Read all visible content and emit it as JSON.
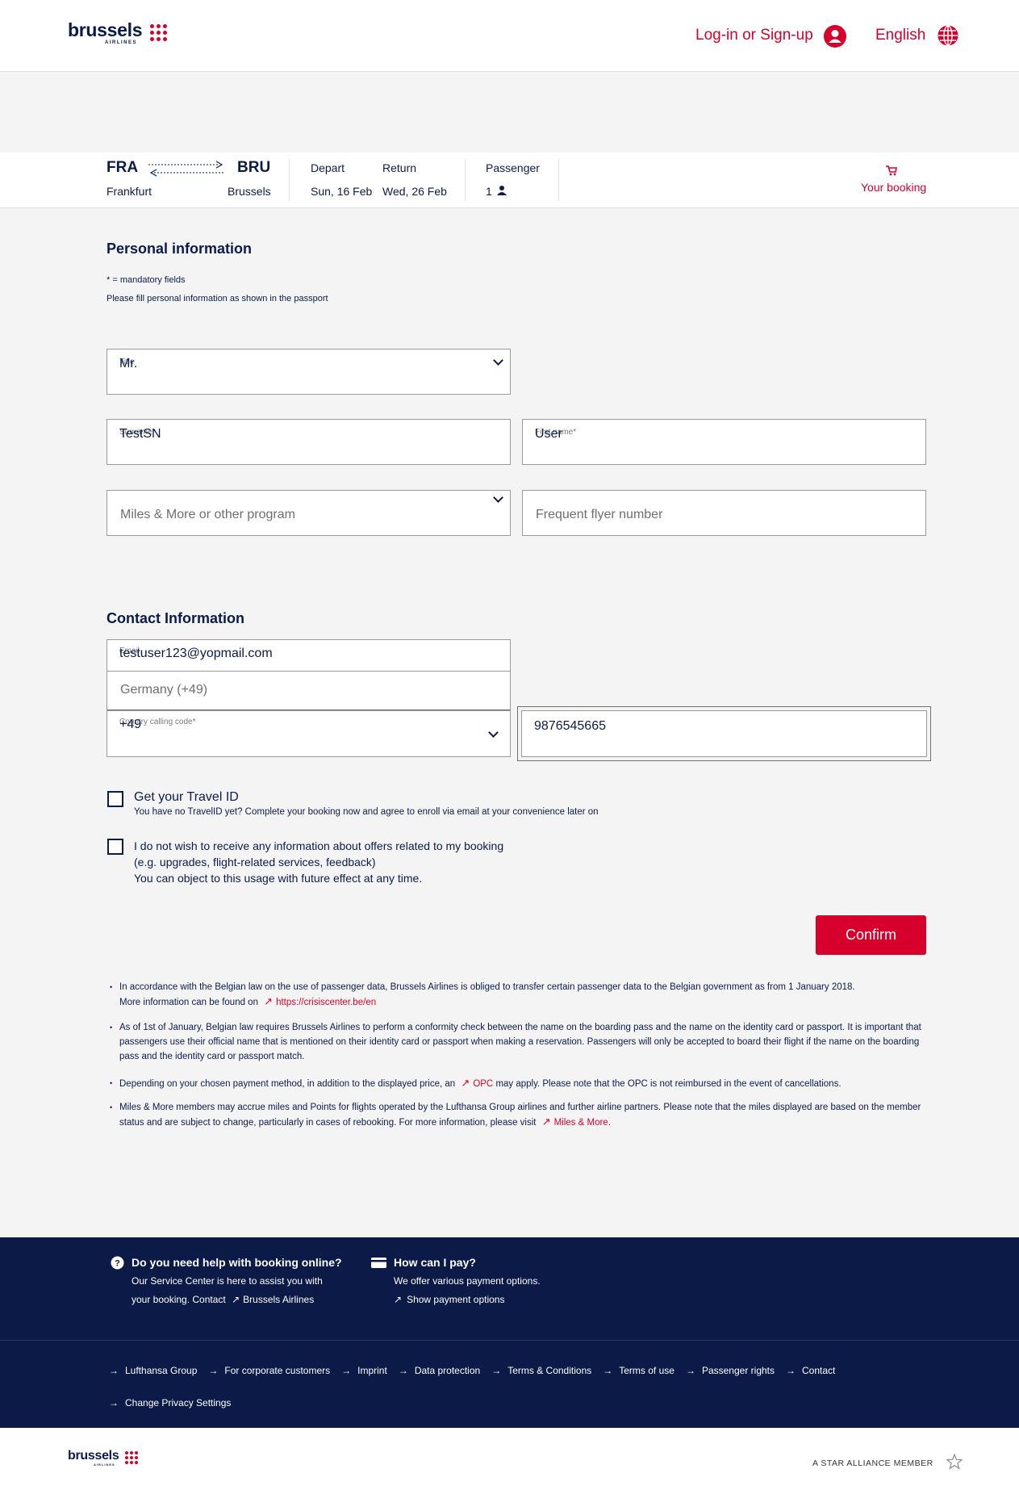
{
  "header": {
    "logo_word": "brussels",
    "logo_sub": "AIRLINES",
    "login_label": "Log-in or Sign-up",
    "language_label": "English"
  },
  "summary": {
    "origin_code": "FRA",
    "origin_city": "Frankfurt",
    "destination_code": "BRU",
    "destination_city": "Brussels",
    "depart_label": "Depart",
    "depart_date": "Sun, 16 Feb",
    "return_label": "Return",
    "return_date": "Wed, 26 Feb",
    "passenger_label": "Passenger",
    "passenger_count": "1",
    "booking_label": "Your booking"
  },
  "personal": {
    "title": "Personal information",
    "mandatory_note": "* = mandatory fields",
    "passport_note": "Please fill personal information as shown in the passport",
    "title_field": {
      "label": "Title",
      "value": "Mr."
    },
    "surname_field": {
      "label": "Surname*",
      "value": "TestSN"
    },
    "first_name_field": {
      "label": "First name*",
      "value": "User"
    },
    "program_field": {
      "placeholder": "Miles & More or other program"
    },
    "ff_number_field": {
      "placeholder": "Frequent flyer number"
    }
  },
  "contact": {
    "title": "Contact Information",
    "email_field": {
      "label": "Email",
      "value": "testuser123@yopmail.com"
    },
    "country_option": "Germany (+49)",
    "calling_code_field": {
      "label": "Country calling code*",
      "value": "+49"
    },
    "phone_field": {
      "value": "9876545665"
    }
  },
  "travel_id": {
    "title": "Get your Travel ID",
    "text": "You have no TravelID yet? Complete your booking now and agree to enroll via email at your convenience later on"
  },
  "marketing": {
    "line1": "I do not wish to receive any information about offers related to my booking",
    "line2": "(e.g. upgrades, flight-related services, feedback)",
    "line3": "You can object to this usage with future effect at any time."
  },
  "confirm_label": "Confirm",
  "notes": {
    "n1_a": "In accordance with the Belgian law on the use of passenger data, Brussels Airlines is obliged to transfer certain passenger data to the Belgian government as from 1 January 2018.",
    "n1_b": "More information can be found on",
    "n1_link": "https://crisiscenter.be/en",
    "n2": "As of 1st of January, Belgian law requires Brussels Airlines to perform a conformity check between the name on the boarding pass and the name on the identity card or passport. It is important that passengers use their official name that is mentioned on their identity card or passport when making a reservation. Passengers will only be accepted to board their flight if the name on the boarding pass and the identity card or passport match.",
    "n3_a": "Depending on your chosen payment method, in addition to the displayed price, an",
    "n3_link": "OPC",
    "n3_b": "may apply. Please note that the OPC is not reimbursed in the event of cancellations.",
    "n4_a": "Miles & More members may accrue miles and Points for flights operated by the Lufthansa Group airlines and further airline partners. Please note that the miles displayed are based on the member status and are subject to change, particularly in cases of rebooking. For more information, please visit",
    "n4_link": "Miles & More."
  },
  "footer": {
    "help_title": "Do you need help with booking online?",
    "help_line1": "Our Service Center is here to assist you with",
    "help_line2": "your booking. Contact",
    "help_link": "Brussels Airlines",
    "pay_title": "How can I pay?",
    "pay_line1": "We offer various payment options.",
    "pay_link": "Show payment options",
    "links": [
      "Lufthansa Group",
      "For corporate customers",
      "Imprint",
      "Data protection",
      "Terms & Conditions",
      "Terms of use",
      "Passenger rights",
      "Contact"
    ],
    "privacy_link": "Change Privacy Settings",
    "star_alliance": "A STAR ALLIANCE MEMBER"
  },
  "colors": {
    "brand_red": "#d7002c",
    "navy": "#0c1a47"
  }
}
